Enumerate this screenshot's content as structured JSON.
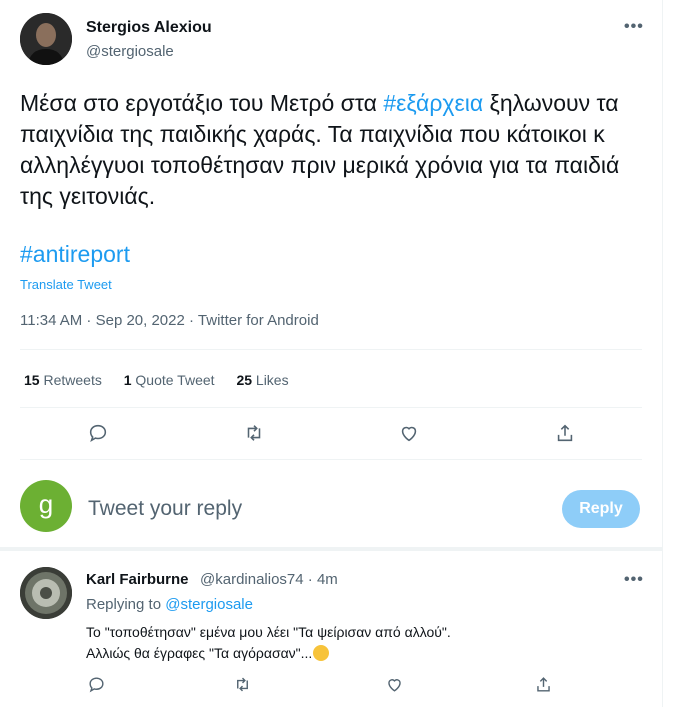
{
  "author": {
    "name": "Stergios Alexiou",
    "handle": "@stergiosale"
  },
  "tweet": {
    "text": "Μέσα στο εργοτάξιο του Μετρό στα ",
    "hashtag_inline": "#εξάρχεια",
    "text_cont": " ξηλωνουν τα παιχνίδια της παιδικής χαράς. Τα παιχνίδια που κάτοικοι κ αλληλέγγυοι τοποθέτησαν πριν μερικά χρόνια για τα παιδιά της γειτονιάς.",
    "hashtag": "#antireport",
    "translate": "Translate Tweet",
    "meta": "11:34 AM · Sep 20, 2022 · Twitter for Android"
  },
  "stats": {
    "retweets_count": "15",
    "retweets_label": "Retweets",
    "quotes_count": "1",
    "quotes_label": "Quote Tweet",
    "likes_count": "25",
    "likes_label": "Likes"
  },
  "actions": [
    "reply-icon",
    "retweet-icon",
    "like-icon",
    "share-icon"
  ],
  "reply_box": {
    "avatar_letter": "g",
    "placeholder": "Tweet your reply",
    "button": "Reply",
    "avatar_color": "#6cb033"
  },
  "reply": {
    "name": "Karl Fairburne",
    "handle_time": "@kardinalios74 · 4m",
    "replying_prefix": "Replying to ",
    "replying_handle": "@stergiosale",
    "line1": "Το \"τοποθέτησαν\" εμένα μου λέει \"Τα ψείρισαν από αλλού\".",
    "line2": "Αλλιώς θα έγραφες \"Τα αγόρασαν\"..."
  },
  "colors": {
    "accent": "#1d9bf0",
    "muted": "#536471",
    "text": "#0f1419",
    "reply_button": "#8ecdf8"
  }
}
